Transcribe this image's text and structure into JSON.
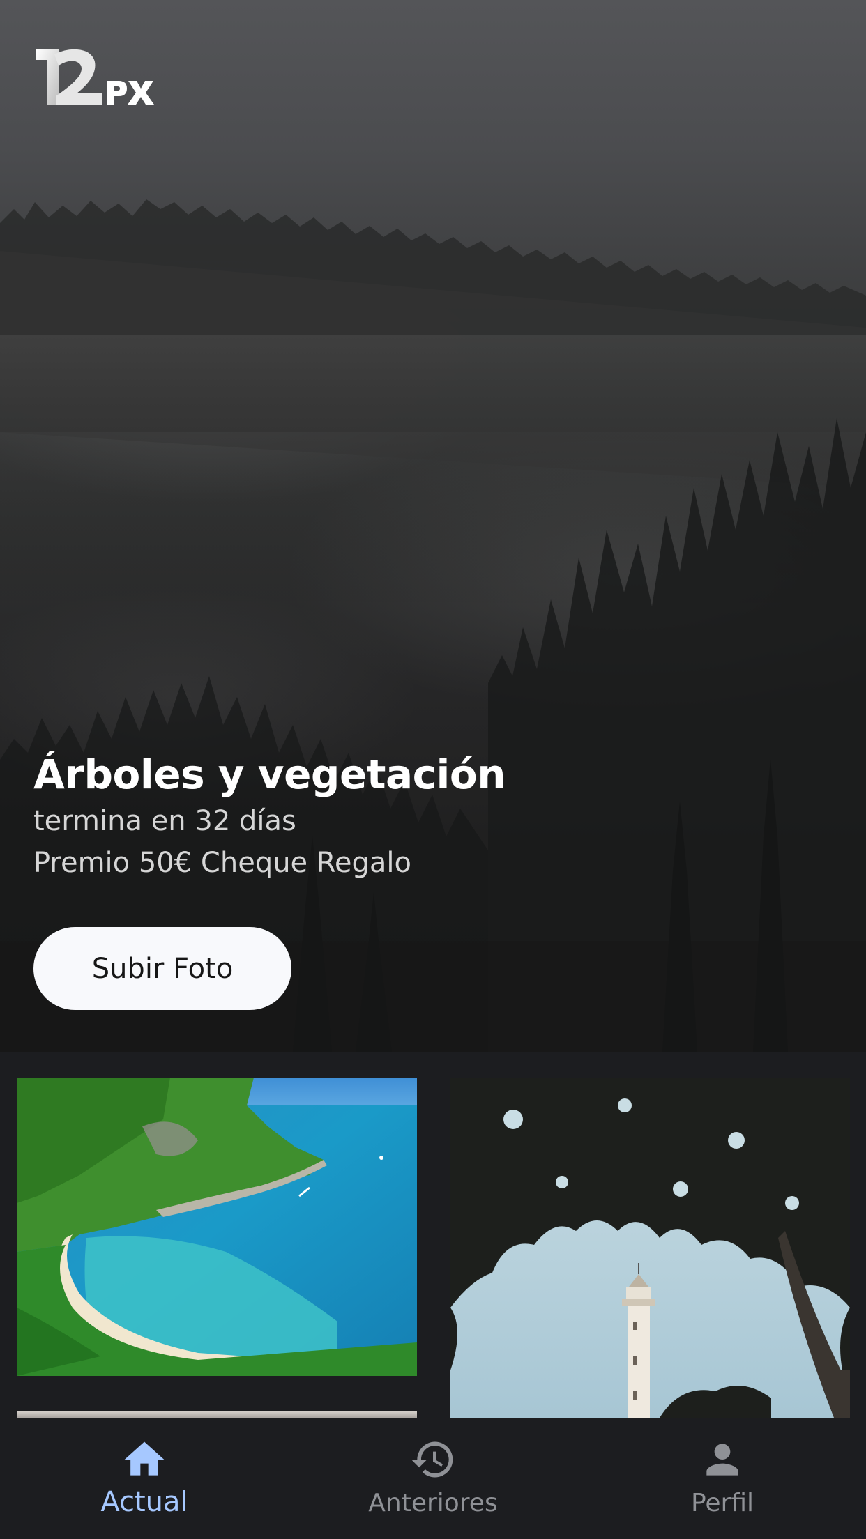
{
  "app": {
    "logo_text": "12PX"
  },
  "contest": {
    "title": "Árboles y vegetación",
    "ends": "termina en 32 días",
    "prize": "Premio 50€ Cheque Regalo",
    "upload_label": "Subir Foto"
  },
  "tabs": [
    {
      "label": "Actual",
      "icon": "home-icon",
      "active": true
    },
    {
      "label": "Anteriores",
      "icon": "history-icon",
      "active": false
    },
    {
      "label": "Perfil",
      "icon": "person-icon",
      "active": false
    }
  ],
  "colors": {
    "active_tab": "#a6c8ff",
    "inactive_tab": "#8f9196",
    "background": "#1c1d20",
    "button": "#f8f9fc"
  }
}
